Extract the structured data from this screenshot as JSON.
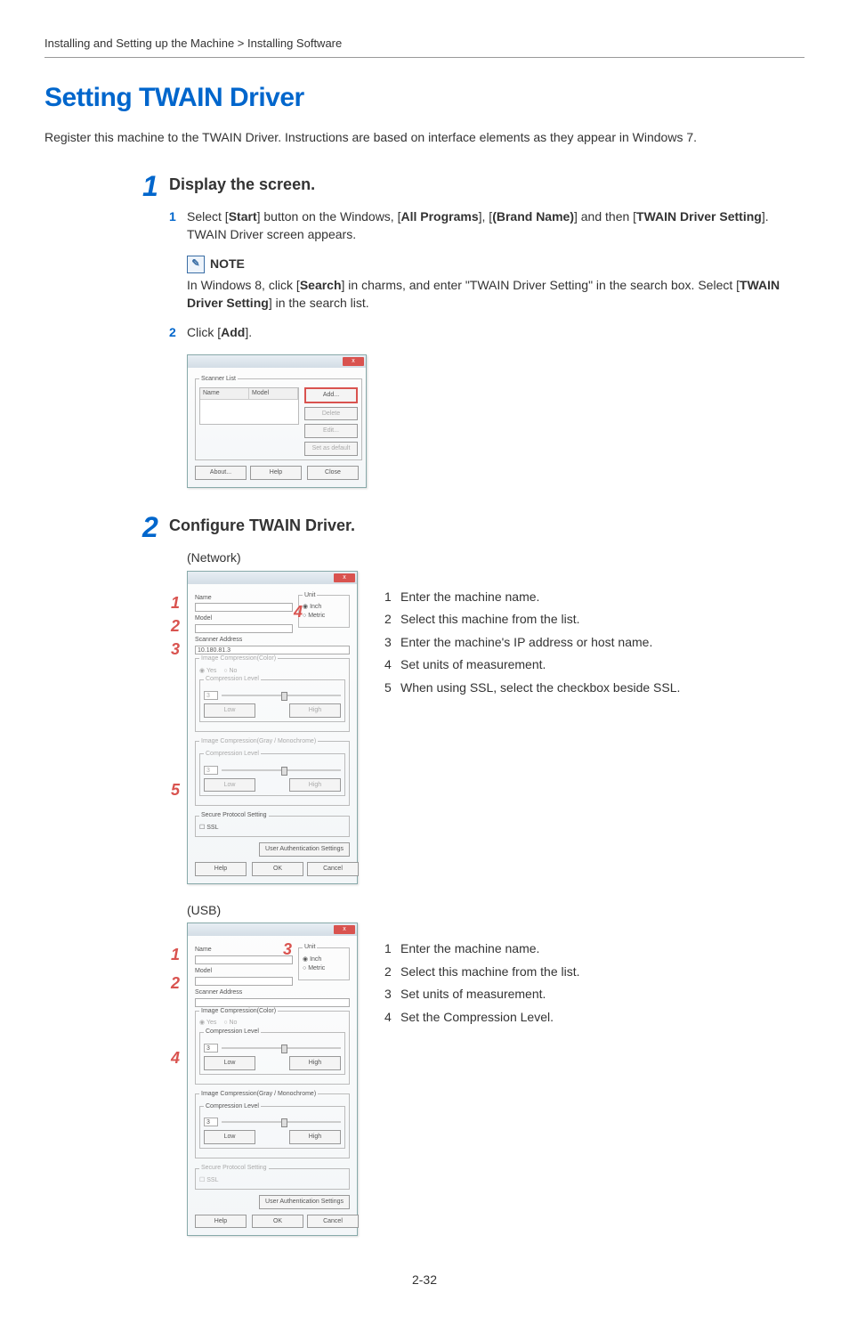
{
  "breadcrumb": "Installing and Setting up the Machine > Installing Software",
  "title": "Setting TWAIN Driver",
  "intro": "Register this machine to the TWAIN Driver. Instructions are based on interface elements as they appear in Windows 7.",
  "step1": {
    "num": "1",
    "title": "Display the screen.",
    "sub1": {
      "num": "1",
      "prefix": "Select [",
      "b1": "Start",
      "t1": "] button on the Windows, [",
      "b2": "All Programs",
      "t2": "], [",
      "b3": "(Brand Name)",
      "t3": "] and then [",
      "b4": "TWAIN Driver Setting",
      "t4": "]. TWAIN Driver screen appears."
    },
    "note": {
      "label": "NOTE",
      "t1": "In Windows 8, click [",
      "b1": "Search",
      "t2": "] in charms, and enter \"TWAIN Driver Setting\" in the search box. Select [",
      "b2": "TWAIN Driver Setting",
      "t3": "] in the search list."
    },
    "sub2": {
      "num": "2",
      "prefix": "Click [",
      "b1": "Add",
      "suffix": "]."
    },
    "dlg1": {
      "scanner_list": "Scanner List",
      "col_name": "Name",
      "col_model": "Model",
      "add": "Add...",
      "delete": "Delete",
      "edit": "Edit...",
      "default": "Set as default",
      "about": "About...",
      "help": "Help",
      "close": "Close"
    }
  },
  "step2": {
    "num": "2",
    "title": "Configure TWAIN Driver.",
    "net_label": "(Network)",
    "usb_label": "(USB)",
    "dlg_net": {
      "name": "Name",
      "model": "Model",
      "unit": "Unit",
      "inch": "Inch",
      "metric": "Metric",
      "addr": "Scanner Address",
      "addr_val": "10.180.81.3",
      "ic_color": "Image Compression(Color)",
      "yes": "Yes",
      "no": "No",
      "cl": "Compression Level",
      "cl_val": "3",
      "low": "Low",
      "high": "High",
      "ic_gm": "Image Compression(Gray / Monochrome)",
      "sps": "Secure Protocol Setting",
      "ssl": "SSL",
      "uas": "User Authentication Settings",
      "help": "Help",
      "ok": "OK",
      "cancel": "Cancel"
    },
    "callouts_net": {
      "c1": "Enter the machine name.",
      "c2": "Select this machine from the list.",
      "c3": "Enter the machine's IP address or host name.",
      "c4": "Set units of measurement.",
      "c5": "When using SSL, select the checkbox beside SSL."
    },
    "callouts_usb": {
      "c1": "Enter the machine name.",
      "c2": "Select this machine from the list.",
      "c3": "Set units of measurement.",
      "c4": "Set the Compression Level."
    },
    "markers": {
      "m1": "1",
      "m2": "2",
      "m3": "3",
      "m4": "4",
      "m5": "5"
    }
  },
  "page_num": "2-32"
}
